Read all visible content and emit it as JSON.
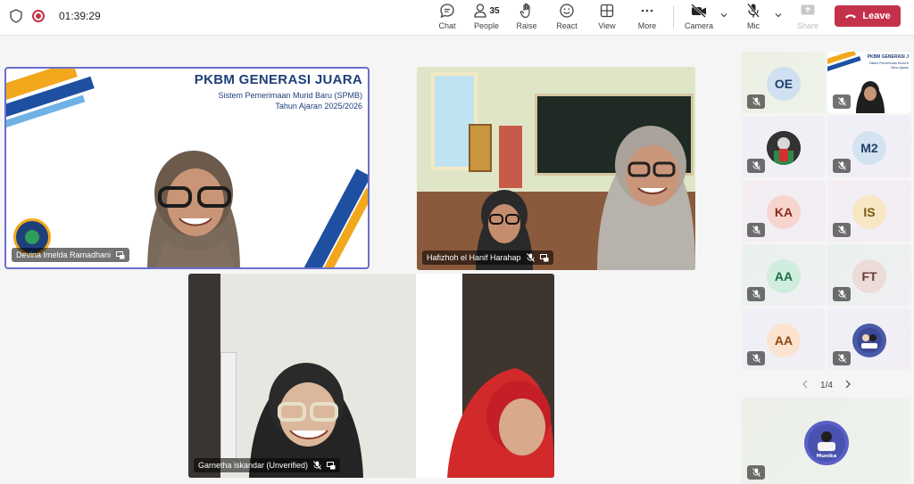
{
  "topbar": {
    "timer": "01:39:29",
    "chat_label": "Chat",
    "people_label": "People",
    "people_count": "35",
    "raise_label": "Raise",
    "react_label": "React",
    "view_label": "View",
    "more_label": "More",
    "camera_label": "Camera",
    "mic_label": "Mic",
    "share_label": "Share",
    "leave_label": "Leave"
  },
  "slide": {
    "title": "PKBM GENERASI JUARA",
    "subtitle": "Sistem Pemerimaan Murid Baru (SPMB)",
    "year": "Tahun Ajaran 2025/2026",
    "thumb_title": "PKBM GENERASI J",
    "thumb_sub": "Sistem Pemerimaan Murid B",
    "thumb_year": "Tahun Ajaran"
  },
  "tiles": [
    {
      "name": "Devina Imelda Ramadhani"
    },
    {
      "name": "Hafizhoh el Hanif Harahap"
    },
    {
      "name": "Garnetha iskandar (Unverified)"
    }
  ],
  "gallery": [
    {
      "initials": "OE",
      "bg": "#cfe0f0",
      "fg": "#1f3d6a"
    },
    {
      "initials": "M2",
      "bg": "#d3e3f2",
      "fg": "#1f3d6a"
    },
    {
      "initials": "KA",
      "bg": "#f7d5cf",
      "fg": "#8a2a1c"
    },
    {
      "initials": "IS",
      "bg": "#f7e7c3",
      "fg": "#7a5510"
    },
    {
      "initials": "AA",
      "bg": "#cfeedd",
      "fg": "#1f6a40"
    },
    {
      "initials": "FT",
      "bg": "#ecdcd8",
      "fg": "#6a3a30"
    },
    {
      "initials": "AA",
      "bg": "#fbe3cf",
      "fg": "#8a4a14"
    }
  ],
  "pager": {
    "label": "1/4"
  },
  "spotlight": {
    "label": "Munika"
  },
  "colors": {
    "accent": "#5b5fc7",
    "leave": "#c4314b",
    "record": "#c4314b"
  }
}
